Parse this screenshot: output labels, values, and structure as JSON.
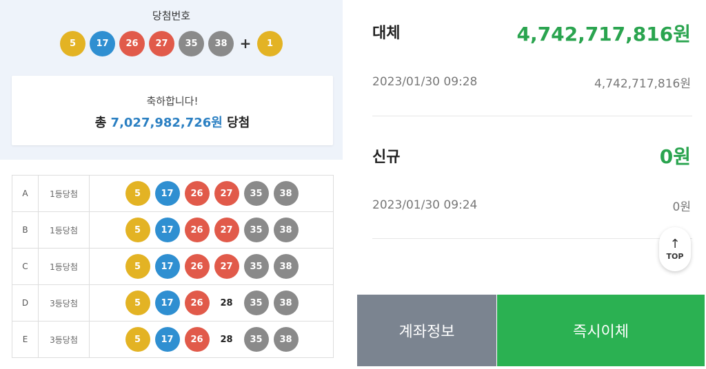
{
  "lotto": {
    "title": "당첨번호",
    "winning_numbers": [
      {
        "num": "5",
        "color": "yellow"
      },
      {
        "num": "17",
        "color": "blue"
      },
      {
        "num": "26",
        "color": "red"
      },
      {
        "num": "27",
        "color": "red"
      },
      {
        "num": "35",
        "color": "gray"
      },
      {
        "num": "38",
        "color": "gray"
      }
    ],
    "plus": "+",
    "bonus": {
      "num": "1",
      "color": "yellow"
    },
    "congrats": "축하합니다!",
    "total_prefix": "총",
    "total_amount": "7,027,982,726원",
    "total_suffix": "당첨",
    "colors": {
      "yellow": "#e3b324",
      "blue": "#2f8fd1",
      "red": "#e15a4a",
      "gray": "#8a8a8a"
    },
    "rows": [
      {
        "letter": "A",
        "rank": "1등당첨",
        "balls": [
          {
            "num": "5",
            "color": "yellow"
          },
          {
            "num": "17",
            "color": "blue"
          },
          {
            "num": "26",
            "color": "red"
          },
          {
            "num": "27",
            "color": "red"
          },
          {
            "num": "35",
            "color": "gray"
          },
          {
            "num": "38",
            "color": "gray"
          }
        ]
      },
      {
        "letter": "B",
        "rank": "1등당첨",
        "balls": [
          {
            "num": "5",
            "color": "yellow"
          },
          {
            "num": "17",
            "color": "blue"
          },
          {
            "num": "26",
            "color": "red"
          },
          {
            "num": "27",
            "color": "red"
          },
          {
            "num": "35",
            "color": "gray"
          },
          {
            "num": "38",
            "color": "gray"
          }
        ]
      },
      {
        "letter": "C",
        "rank": "1등당첨",
        "balls": [
          {
            "num": "5",
            "color": "yellow"
          },
          {
            "num": "17",
            "color": "blue"
          },
          {
            "num": "26",
            "color": "red"
          },
          {
            "num": "27",
            "color": "red"
          },
          {
            "num": "35",
            "color": "gray"
          },
          {
            "num": "38",
            "color": "gray"
          }
        ]
      },
      {
        "letter": "D",
        "rank": "3등당첨",
        "balls": [
          {
            "num": "5",
            "color": "yellow"
          },
          {
            "num": "17",
            "color": "blue"
          },
          {
            "num": "26",
            "color": "red"
          },
          {
            "num": "28",
            "color": "none"
          },
          {
            "num": "35",
            "color": "gray"
          },
          {
            "num": "38",
            "color": "gray"
          }
        ]
      },
      {
        "letter": "E",
        "rank": "3등당첨",
        "balls": [
          {
            "num": "5",
            "color": "yellow"
          },
          {
            "num": "17",
            "color": "blue"
          },
          {
            "num": "26",
            "color": "red"
          },
          {
            "num": "28",
            "color": "none"
          },
          {
            "num": "35",
            "color": "gray"
          },
          {
            "num": "38",
            "color": "gray"
          }
        ]
      }
    ]
  },
  "bank": {
    "transactions": [
      {
        "name": "대체",
        "amount": "4,742,717,816원",
        "datetime": "2023/01/30  09:28",
        "balance": "4,742,717,816원"
      },
      {
        "name": "신규",
        "amount": "0원",
        "datetime": "2023/01/30  09:24",
        "balance": "0원"
      }
    ],
    "top_button": {
      "arrow": "↑",
      "label": "TOP"
    },
    "account_info_label": "계좌정보",
    "instant_transfer_label": "즉시이체",
    "colors": {
      "amount_green": "#2aa44f",
      "account_button": "#7b8490",
      "transfer_button": "#2bb152"
    }
  }
}
